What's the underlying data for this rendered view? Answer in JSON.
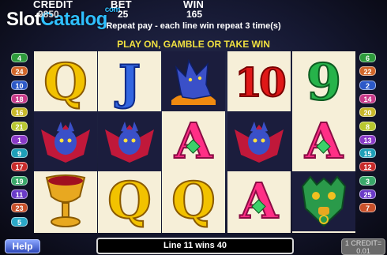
{
  "meters": {
    "credit_label": "CREDIT",
    "credit_value": "9850",
    "bet_label": "BET",
    "bet_value": "25",
    "win_label": "WIN",
    "win_value": "165"
  },
  "brand": {
    "part1": "Slot",
    "part2": "Catalog",
    "part3": "com"
  },
  "messages": {
    "repeat": "Repeat pay - each line win repeat 3 time(s)",
    "play": "PLAY ON, GAMBLE OR TAKE WIN"
  },
  "left_lines": [
    "4",
    "24",
    "10",
    "18",
    "16",
    "21",
    "1",
    "9",
    "17",
    "19",
    "11",
    "23",
    "5"
  ],
  "right_lines": [
    "6",
    "22",
    "2",
    "14",
    "20",
    "8",
    "13",
    "15",
    "12",
    "3",
    "25",
    "7"
  ],
  "reels": [
    [
      "Q",
      "wolf-bat",
      "goblet"
    ],
    [
      "J",
      "wolf-bat",
      "Q"
    ],
    [
      "wolf-moon",
      "A",
      "Q"
    ],
    [
      "10",
      "wolf-bat",
      "A"
    ],
    [
      "9",
      "A",
      "mask"
    ]
  ],
  "reel_top_left": [
    "Q",
    "10"
  ],
  "bottom": {
    "help_label": "Help",
    "line_win_text": "Line 11 wins 40",
    "credit_denom": "1 CREDIT=",
    "credit_denom_value": "0.01"
  },
  "colors": {
    "background": "#161933",
    "reel_bg": "#f6efd8",
    "play_text": "#f0e040",
    "win_cell_bg": "#1b1d3d"
  }
}
